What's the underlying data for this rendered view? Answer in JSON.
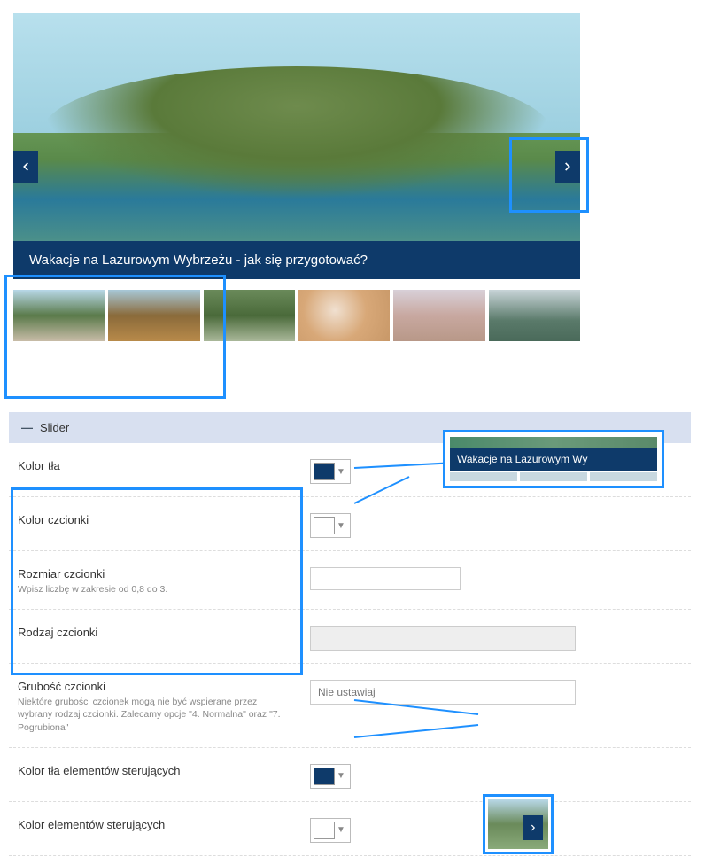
{
  "hero": {
    "caption": "Wakacje na Lazurowym Wybrzeżu - jak się przygotować?"
  },
  "panel": {
    "title": "Slider"
  },
  "settings": {
    "bg_color": {
      "label": "Kolor tła",
      "swatch": "#0e3a6a"
    },
    "font_color": {
      "label": "Kolor czcionki",
      "swatch": "#ffffff"
    },
    "font_size": {
      "label": "Rozmiar czcionki",
      "hint": "Wpisz liczbę w zakresie od 0,8 do 3.",
      "value": ""
    },
    "font_family": {
      "label": "Rodzaj czcionki"
    },
    "font_weight": {
      "label": "Grubość czcionki",
      "hint": "Niektóre grubości czcionek mogą nie być wspierane przez wybrany rodzaj czcionki. Zalecamy opcje \"4. Normalna\" oraz \"7. Pogrubiona\"",
      "placeholder": "Nie ustawiaj"
    },
    "ctrl_bg": {
      "label": "Kolor tła elementów sterujących",
      "swatch": "#0e3a6a"
    },
    "ctrl_color": {
      "label": "Kolor elementów sterujących",
      "swatch": "#ffffff"
    }
  },
  "preview": {
    "caption_text": "Wakacje na Lazurowym Wy"
  }
}
